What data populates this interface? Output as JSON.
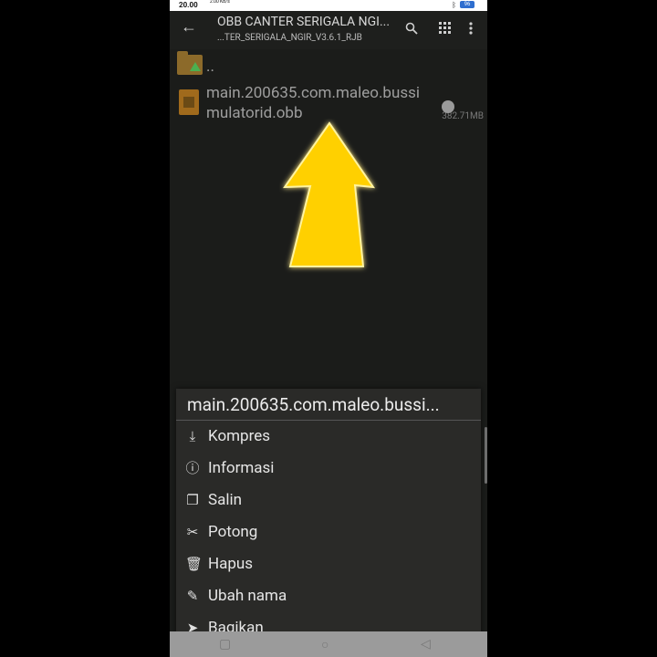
{
  "status_bar": {
    "time": "20.00",
    "network": "2.00 KB/s",
    "battery": "96",
    "icons": [
      "signal-icon",
      "wifi-icon",
      "bluetooth-icon",
      "battery-icon"
    ]
  },
  "app_bar": {
    "title": "OBB CANTER SERIGALA NGI...",
    "subtitle": "...TER_SERIGALA_NGIR_V3.6.1_RJB",
    "icons": [
      "back-icon",
      "search-icon",
      "grid-icon",
      "more-vert-icon"
    ]
  },
  "file_list": {
    "items": [
      {
        "name": "..",
        "type": "parent-folder"
      },
      {
        "name_line1": "main.200635.com.maleo.bussi",
        "name_line2": "mulatorid.obb",
        "size": "382.71MB",
        "type": "obb"
      }
    ]
  },
  "annotation": {
    "color": "#FFD000",
    "icon": "up-arrow-overlay"
  },
  "context_menu": {
    "title": "main.200635.com.maleo.bussi...",
    "items": [
      {
        "label": "Kompres",
        "icon": "download-icon"
      },
      {
        "label": "Informasi",
        "icon": "info-icon"
      },
      {
        "label": "Salin",
        "icon": "copy-icon"
      },
      {
        "label": "Potong",
        "icon": "scissors-icon"
      },
      {
        "label": "Hapus",
        "icon": "trash-icon"
      },
      {
        "label": "Ubah nama",
        "icon": "pencil-icon"
      },
      {
        "label": "Bagikan",
        "icon": "share-icon"
      }
    ]
  },
  "nav_bar": {
    "icons": [
      "recents-icon",
      "home-icon",
      "back-nav-icon"
    ]
  }
}
